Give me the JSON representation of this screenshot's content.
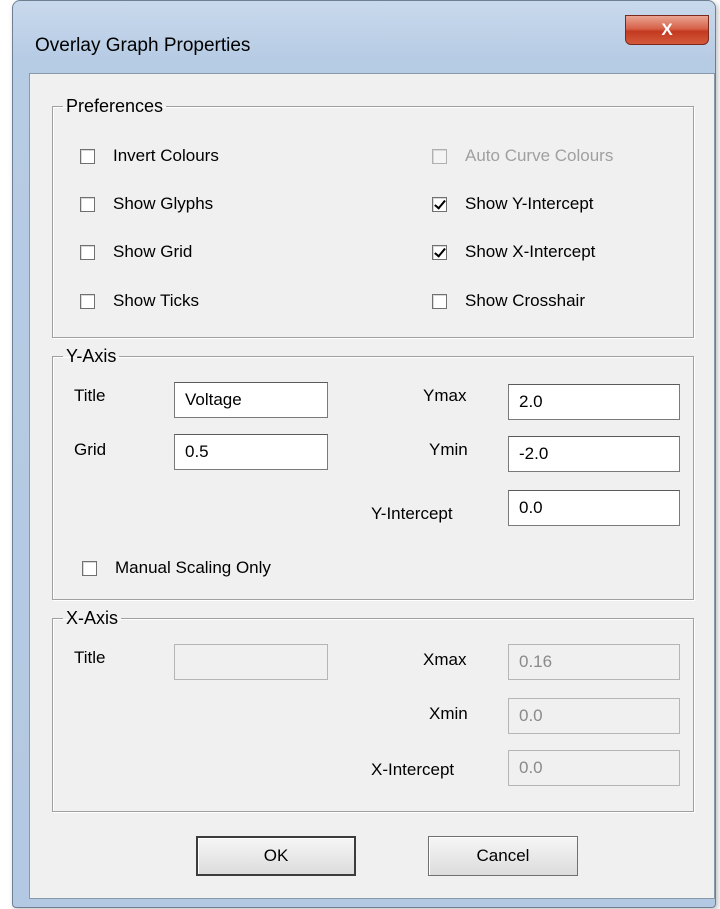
{
  "window": {
    "title": "Overlay Graph Properties",
    "close_glyph": "X"
  },
  "preferences": {
    "legend": "Preferences",
    "options": [
      {
        "label": "Invert Colours",
        "checked": false,
        "enabled": true
      },
      {
        "label": "Show Glyphs",
        "checked": false,
        "enabled": true
      },
      {
        "label": "Show Grid",
        "checked": false,
        "enabled": true
      },
      {
        "label": "Show Ticks",
        "checked": false,
        "enabled": true
      },
      {
        "label": "Auto Curve Colours",
        "checked": false,
        "enabled": false
      },
      {
        "label": "Show Y-Intercept",
        "checked": true,
        "enabled": true
      },
      {
        "label": "Show X-Intercept",
        "checked": true,
        "enabled": true
      },
      {
        "label": "Show Crosshair",
        "checked": false,
        "enabled": true
      }
    ]
  },
  "y_axis": {
    "legend": "Y-Axis",
    "title_label": "Title",
    "title_value": "Voltage",
    "grid_label": "Grid",
    "grid_value": "0.5",
    "ymax_label": "Ymax",
    "ymax_value": "2.0",
    "ymin_label": "Ymin",
    "ymin_value": "-2.0",
    "yintercept_label": "Y-Intercept",
    "yintercept_value": "0.0",
    "manual_scaling_label": "Manual Scaling Only",
    "manual_scaling_checked": false
  },
  "x_axis": {
    "legend": "X-Axis",
    "title_label": "Title",
    "title_value": "",
    "xmax_label": "Xmax",
    "xmax_value": "0.16",
    "xmin_label": "Xmin",
    "xmin_value": "0.0",
    "xintercept_label": "X-Intercept",
    "xintercept_value": "0.0"
  },
  "buttons": {
    "ok": "OK",
    "cancel": "Cancel"
  }
}
